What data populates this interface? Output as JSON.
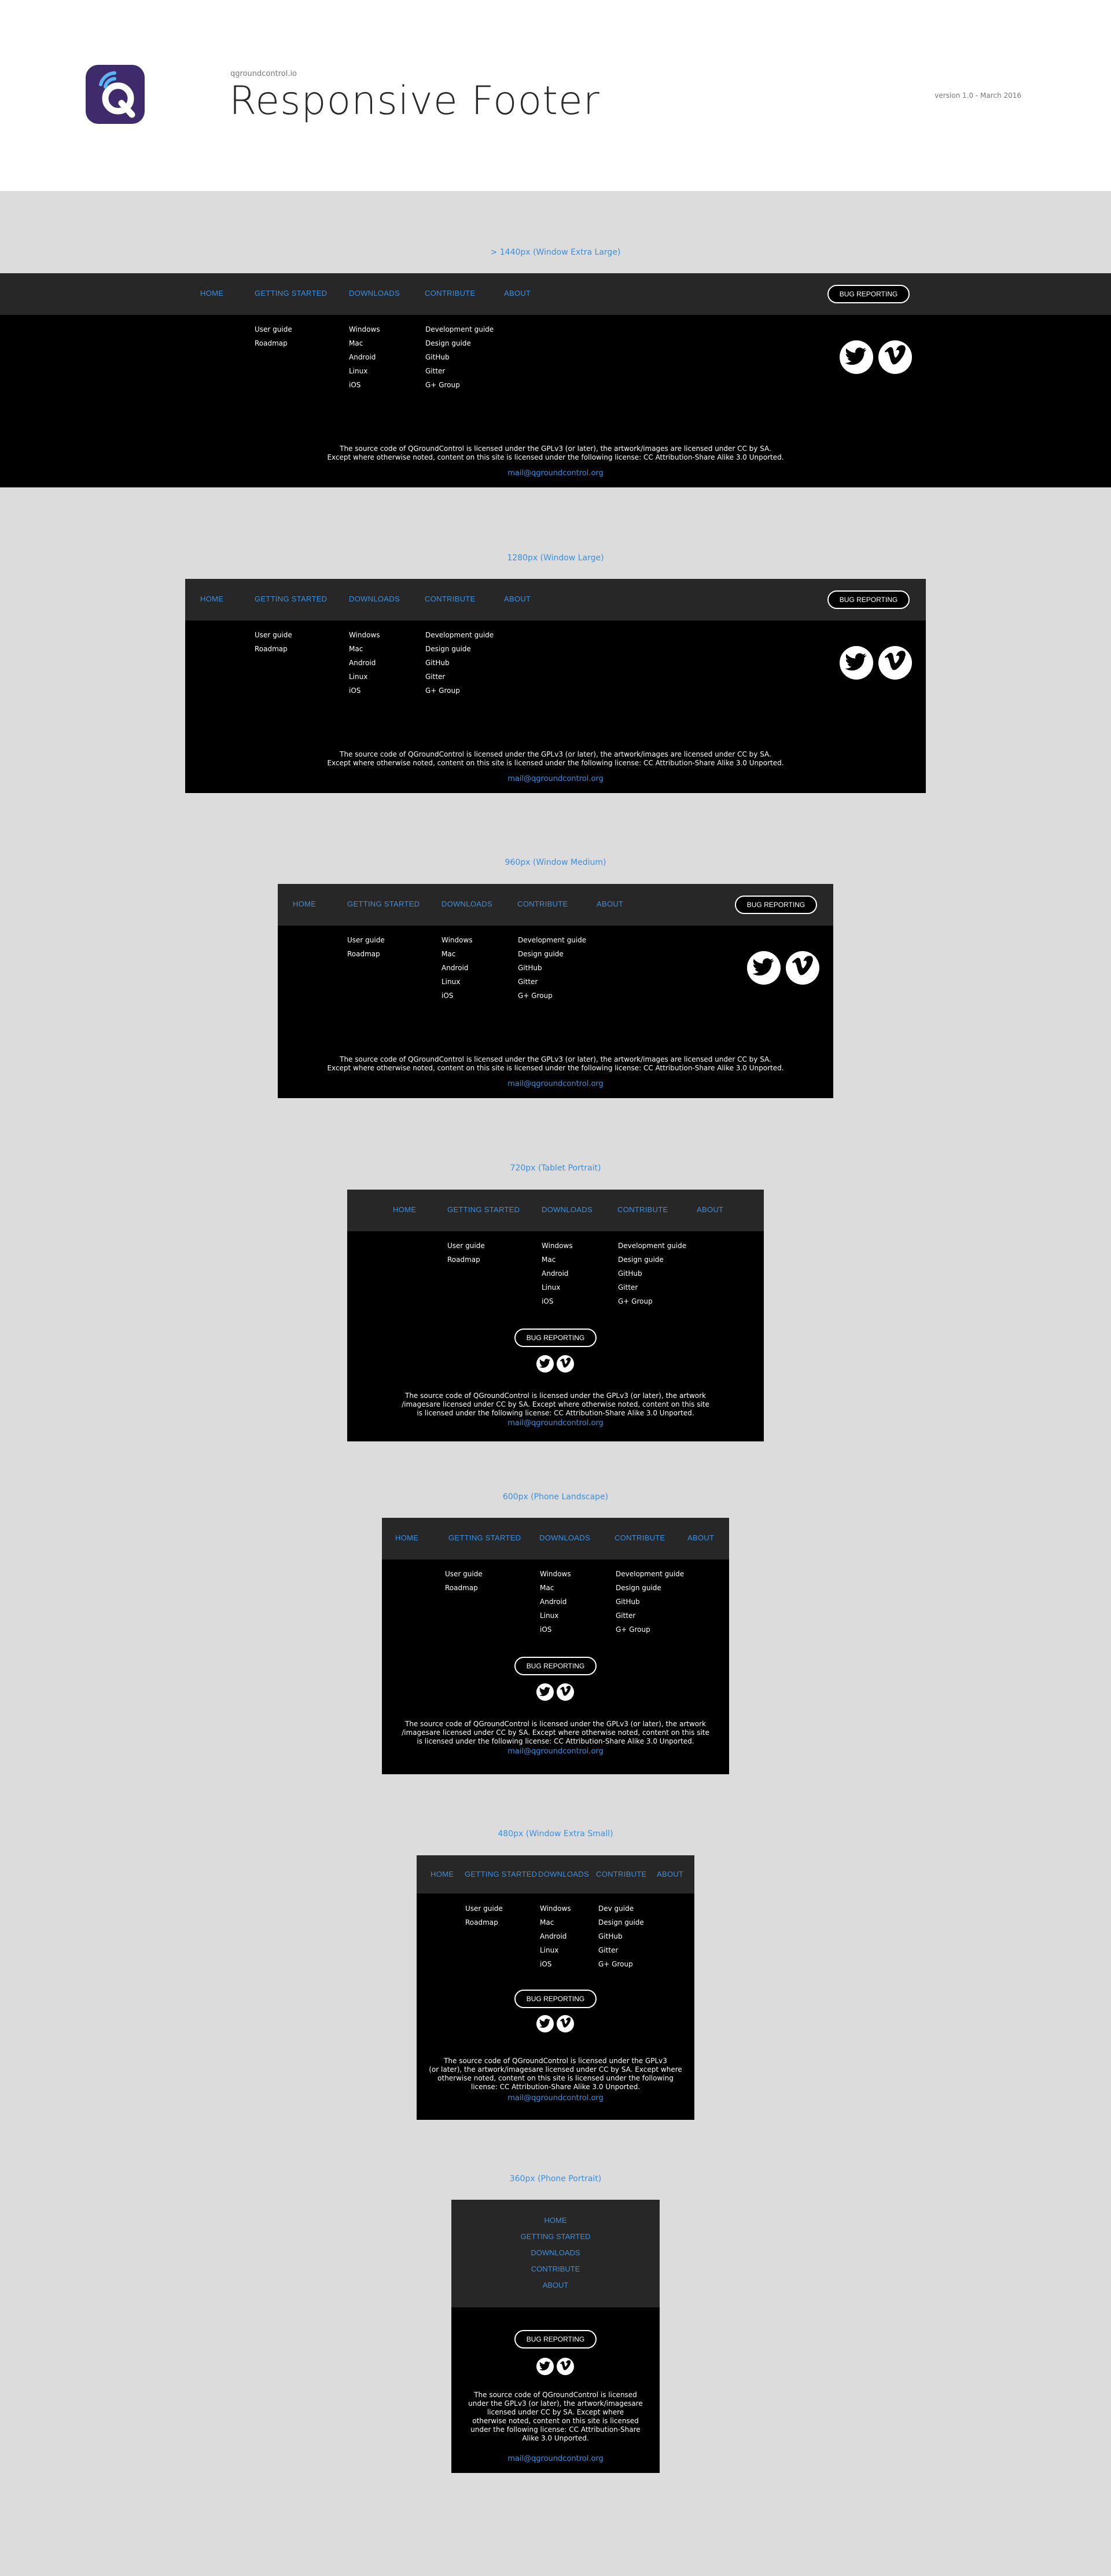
{
  "header": {
    "site": "qgroundcontrol.io",
    "title": "Responsive Footer",
    "version": "version 1.0 - March 2016"
  },
  "nav": [
    "HOME",
    "GETTING STARTED",
    "DOWNLOADS",
    "CONTRIBUTE",
    "ABOUT"
  ],
  "getting_started": [
    "User guide",
    "Roadmap"
  ],
  "downloads": [
    "Windows",
    "Mac",
    "Android",
    "Linux",
    "iOS"
  ],
  "contribute": [
    "Development guide",
    "Design guide",
    "GitHub",
    "Gitter",
    "G+ Group"
  ],
  "contribute_xs": [
    "Dev guide",
    "Design guide",
    "GitHub",
    "Gitter",
    "G+ Group"
  ],
  "bug_button": "BUG REPORTING",
  "social": [
    "twitter-icon",
    "vimeo-icon"
  ],
  "legal_line1": "The source code of QGroundControl is licensed under the GPLv3 (or later), the artwork/images are licensed under CC by SA.",
  "legal_line2": "Except where otherwise noted, content on this site is licensed under the following license: CC Attribution-Share Alike 3.0 Unported.",
  "legal_tablet": [
    "The source code of QGroundControl is licensed under the GPLv3 (or later), the artwork",
    "/imagesare licensed under CC by SA. Except where otherwise noted, content on this site",
    "is licensed under the following license: CC Attribution-Share Alike 3.0 Unported."
  ],
  "legal_xs": [
    "The source code of QGroundControl is licensed under the GPLv3",
    "(or later), the artwork/imagesare licensed under CC by SA. Except where",
    "otherwise noted, content on this site is licensed under the following",
    "license: CC Attribution-Share Alike 3.0 Unported."
  ],
  "legal_phone": [
    "The source code of QGroundControl is licensed",
    "under the GPLv3 (or later), the artwork/imagesare",
    "licensed under CC by SA. Except where",
    "otherwise noted, content on this site is licensed",
    "under the following license: CC Attribution-Share",
    "Alike 3.0 Unported."
  ],
  "mail": "mail@qgroundcontrol.org",
  "variants": [
    {
      "label": "> 1440px (Window Extra Large)"
    },
    {
      "label": "1280px (Window Large)"
    },
    {
      "label": "960px (Window Medium)"
    },
    {
      "label": "720px (Tablet Portrait)"
    },
    {
      "label": "600px (Phone Landscape)"
    },
    {
      "label": "480px (Window Extra Small)"
    },
    {
      "label": "360px (Phone Portrait)"
    }
  ],
  "colors": {
    "accent": "#3b8fe0",
    "nav_bg": "#272727",
    "frame_bg": "#000000",
    "page_bg": "#dcdcdc"
  }
}
